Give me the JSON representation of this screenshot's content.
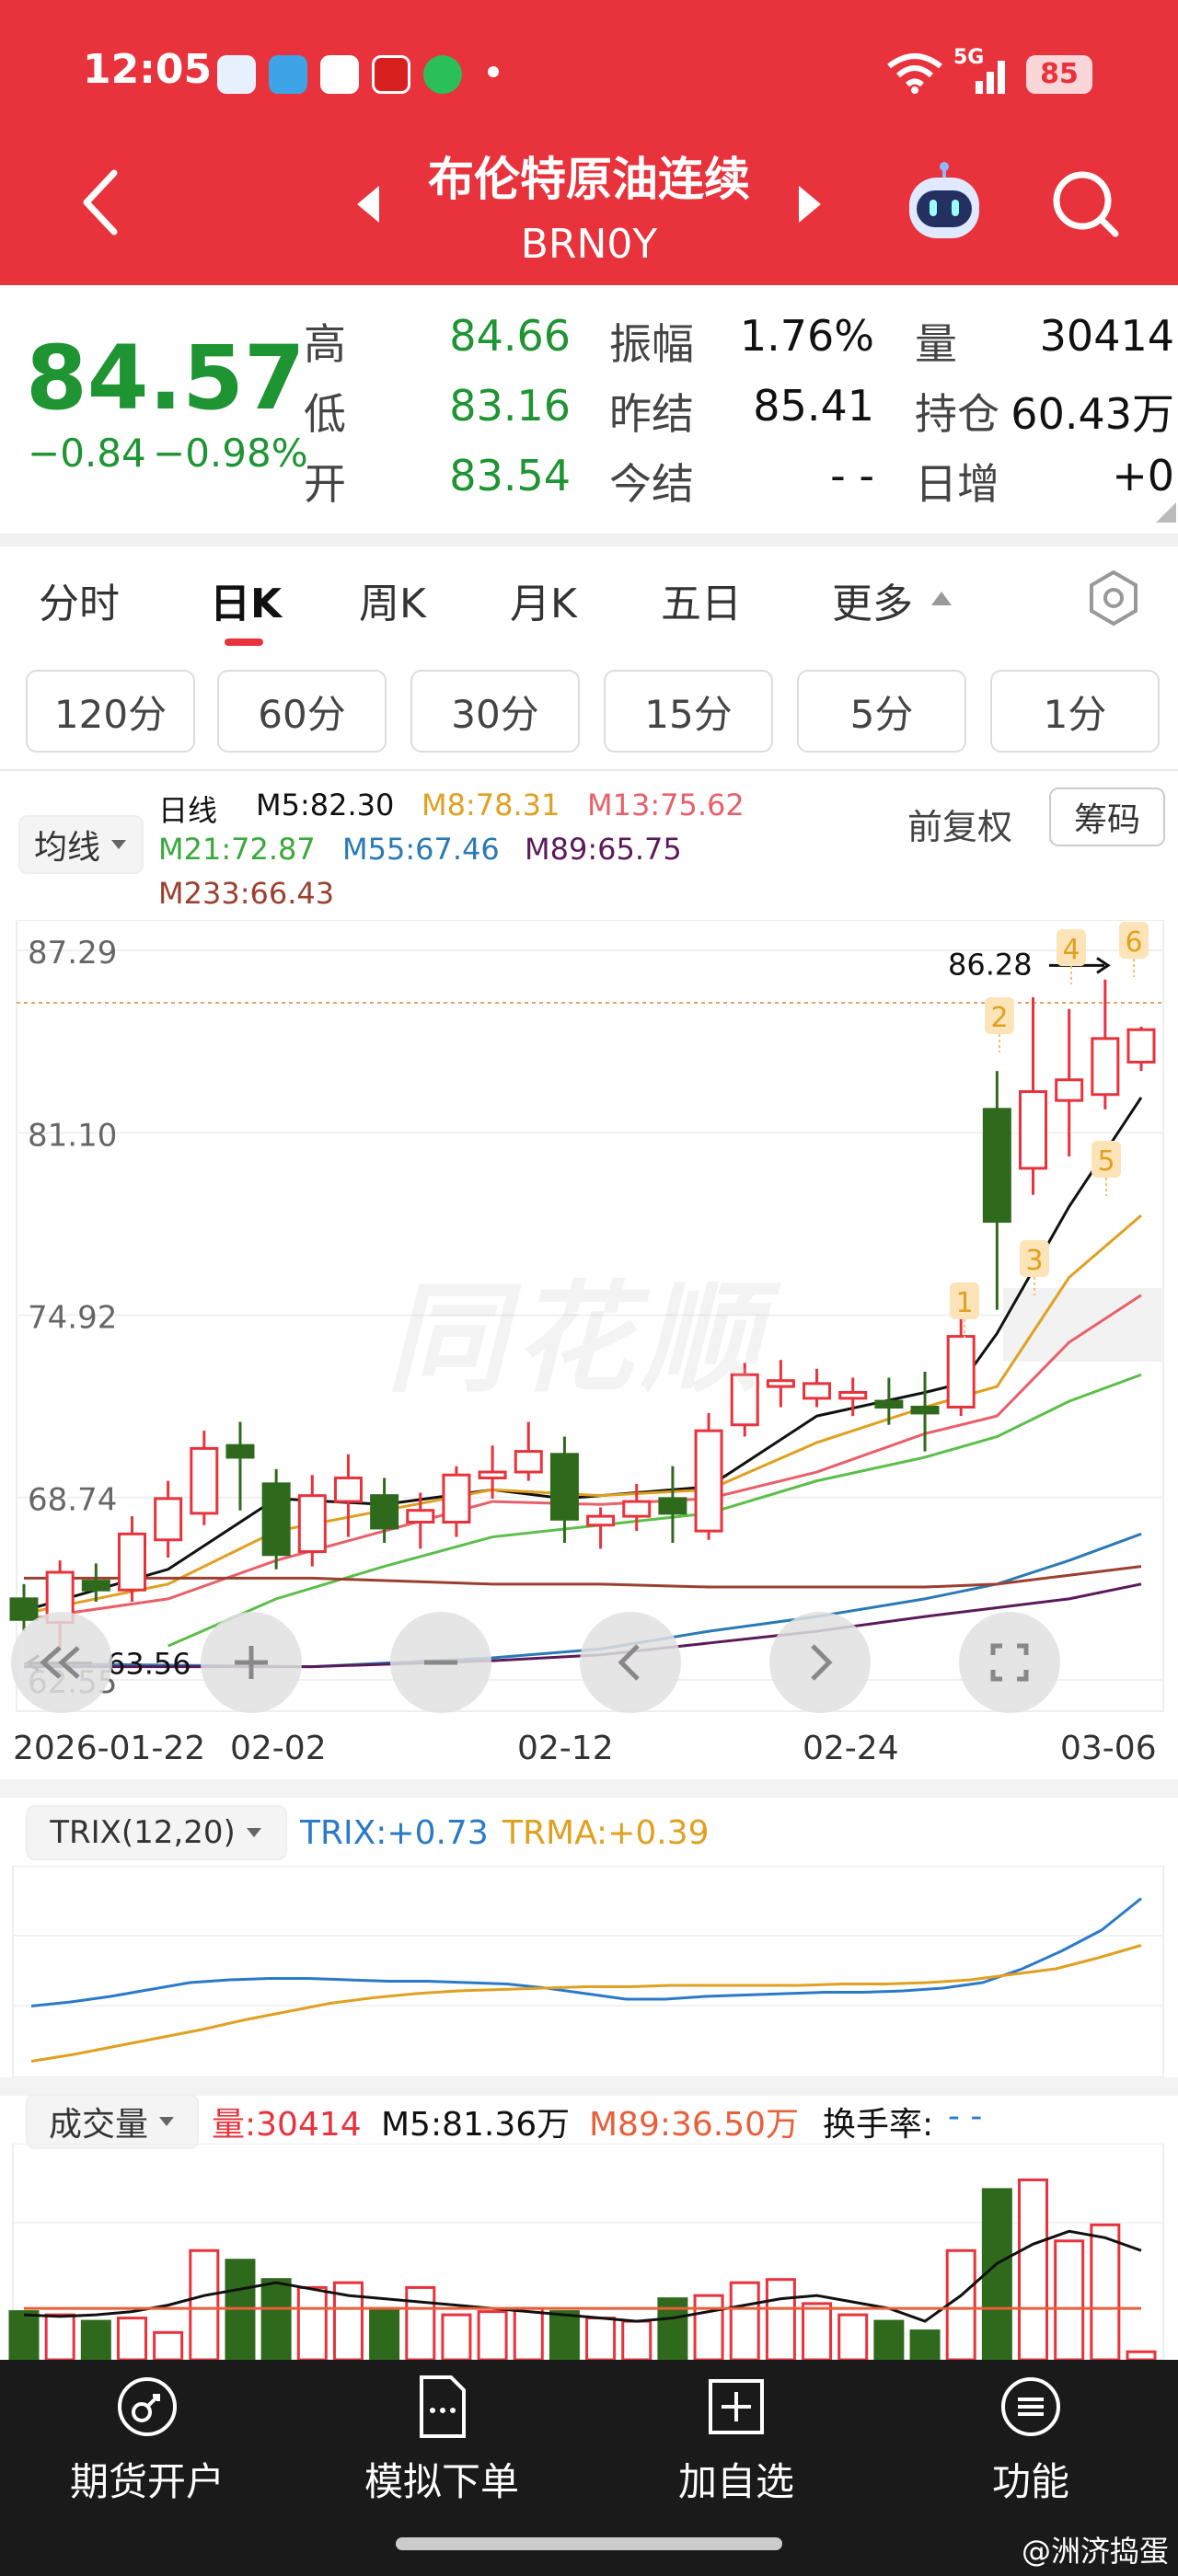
{
  "status": {
    "time": "12:05",
    "network": "5G",
    "battery": "85"
  },
  "header": {
    "title": "布伦特原油连续",
    "code": "BRN0Y"
  },
  "quote": {
    "price": "84.57",
    "change": "−0.84",
    "change_pct": "−0.98%",
    "high_label": "高",
    "high": "84.66",
    "low_label": "低",
    "low": "83.16",
    "open_label": "开",
    "open": "83.54",
    "amplitude_label": "振幅",
    "amplitude": "1.76%",
    "prev_settle_label": "昨结",
    "prev_settle": "85.41",
    "settle_label": "今结",
    "settle": "- -",
    "volume_label": "量",
    "volume": "30414",
    "position_label": "持仓",
    "position": "60.43万",
    "daily_inc_label": "日增",
    "daily_inc": "+0"
  },
  "tabs": [
    "分时",
    "日K",
    "周K",
    "月K",
    "五日",
    "更多"
  ],
  "chips": [
    "120分",
    "60分",
    "30分",
    "15分",
    "5分",
    "1分"
  ],
  "ma": {
    "selector": "均线",
    "period": "日线",
    "m5": "M5:82.30",
    "m8": "M8:78.31",
    "m13": "M13:75.62",
    "m21": "M21:72.87",
    "m55": "M55:67.46",
    "m89": "M89:65.75",
    "m233": "M233:66.43",
    "adjust": "前复权",
    "chip_button": "筹码"
  },
  "watermark": "同花顺",
  "chart_data": {
    "type": "candlestick",
    "y_ticks": [
      "87.29",
      "81.10",
      "74.92",
      "68.74",
      "62.55"
    ],
    "ylim": [
      62.55,
      87.29
    ],
    "x_ticks": [
      "2026-01-22",
      "02-02",
      "02-12",
      "02-24",
      "03-06"
    ],
    "high_marker": "86.28",
    "low_marker": "63.56",
    "badges": [
      "1",
      "2",
      "3",
      "4",
      "5",
      "6"
    ],
    "candles": [
      {
        "o": 65.3,
        "h": 65.8,
        "l": 64.2,
        "c": 64.6
      },
      {
        "o": 64.5,
        "h": 66.6,
        "l": 63.6,
        "c": 66.2
      },
      {
        "o": 65.9,
        "h": 66.5,
        "l": 65.2,
        "c": 65.6
      },
      {
        "o": 65.6,
        "h": 68.1,
        "l": 65.2,
        "c": 67.5
      },
      {
        "o": 67.3,
        "h": 69.3,
        "l": 66.7,
        "c": 68.7
      },
      {
        "o": 68.2,
        "h": 71.0,
        "l": 67.8,
        "c": 70.4
      },
      {
        "o": 70.5,
        "h": 71.3,
        "l": 68.3,
        "c": 70.1
      },
      {
        "o": 69.2,
        "h": 69.7,
        "l": 66.3,
        "c": 66.8
      },
      {
        "o": 66.9,
        "h": 69.5,
        "l": 66.4,
        "c": 68.8
      },
      {
        "o": 68.6,
        "h": 70.2,
        "l": 67.4,
        "c": 69.4
      },
      {
        "o": 68.8,
        "h": 69.4,
        "l": 67.2,
        "c": 67.7
      },
      {
        "o": 67.9,
        "h": 68.9,
        "l": 67.0,
        "c": 68.3
      },
      {
        "o": 67.9,
        "h": 69.8,
        "l": 67.4,
        "c": 69.5
      },
      {
        "o": 69.4,
        "h": 70.5,
        "l": 68.7,
        "c": 69.6
      },
      {
        "o": 69.6,
        "h": 71.3,
        "l": 69.3,
        "c": 70.3
      },
      {
        "o": 70.2,
        "h": 70.8,
        "l": 67.2,
        "c": 68.0
      },
      {
        "o": 67.8,
        "h": 68.4,
        "l": 67.0,
        "c": 68.1
      },
      {
        "o": 68.1,
        "h": 69.2,
        "l": 67.6,
        "c": 68.6
      },
      {
        "o": 68.7,
        "h": 69.8,
        "l": 67.2,
        "c": 68.2
      },
      {
        "o": 67.6,
        "h": 71.6,
        "l": 67.3,
        "c": 71.0
      },
      {
        "o": 71.2,
        "h": 73.3,
        "l": 70.8,
        "c": 72.9
      },
      {
        "o": 72.5,
        "h": 73.4,
        "l": 71.8,
        "c": 72.7
      },
      {
        "o": 72.1,
        "h": 73.1,
        "l": 71.8,
        "c": 72.6
      },
      {
        "o": 72.1,
        "h": 72.8,
        "l": 71.5,
        "c": 72.3
      },
      {
        "o": 72.0,
        "h": 72.8,
        "l": 71.2,
        "c": 71.8
      },
      {
        "o": 71.8,
        "h": 73.0,
        "l": 70.3,
        "c": 71.6
      },
      {
        "o": 71.8,
        "h": 75.0,
        "l": 71.5,
        "c": 74.2
      },
      {
        "o": 81.9,
        "h": 83.2,
        "l": 75.1,
        "c": 78.1
      },
      {
        "o": 79.9,
        "h": 85.7,
        "l": 79.0,
        "c": 82.5
      },
      {
        "o": 82.2,
        "h": 85.3,
        "l": 80.3,
        "c": 82.9
      },
      {
        "o": 82.4,
        "h": 86.3,
        "l": 81.9,
        "c": 84.3
      },
      {
        "o": 83.5,
        "h": 84.7,
        "l": 83.2,
        "c": 84.6
      }
    ],
    "ma_series": [
      {
        "name": "M5",
        "color": "#111111",
        "values": [
          [
            0,
            64.9
          ],
          [
            4,
            66.3
          ],
          [
            7,
            68.7
          ],
          [
            10,
            68.5
          ],
          [
            13,
            69.0
          ],
          [
            15,
            68.7
          ],
          [
            19,
            69.1
          ],
          [
            22,
            71.5
          ],
          [
            25,
            72.3
          ],
          [
            26,
            72.6
          ],
          [
            27,
            74.3
          ],
          [
            29,
            78.6
          ],
          [
            31,
            82.3
          ]
        ]
      },
      {
        "name": "M8",
        "color": "#e0a020",
        "values": [
          [
            0,
            64.8
          ],
          [
            4,
            65.8
          ],
          [
            7,
            67.6
          ],
          [
            10,
            68.3
          ],
          [
            13,
            69.0
          ],
          [
            16,
            68.8
          ],
          [
            19,
            69.0
          ],
          [
            22,
            70.6
          ],
          [
            25,
            71.8
          ],
          [
            27,
            72.5
          ],
          [
            29,
            76.2
          ],
          [
            31,
            78.3
          ]
        ]
      },
      {
        "name": "M13",
        "color": "#e8606a",
        "values": [
          [
            0,
            64.6
          ],
          [
            4,
            65.3
          ],
          [
            7,
            66.6
          ],
          [
            10,
            67.6
          ],
          [
            13,
            68.6
          ],
          [
            16,
            68.5
          ],
          [
            19,
            68.7
          ],
          [
            22,
            69.6
          ],
          [
            25,
            70.9
          ],
          [
            27,
            71.5
          ],
          [
            29,
            74.0
          ],
          [
            31,
            75.6
          ]
        ]
      },
      {
        "name": "M21",
        "color": "#5bbf4a",
        "values": [
          [
            4,
            63.7
          ],
          [
            7,
            65.3
          ],
          [
            10,
            66.4
          ],
          [
            13,
            67.4
          ],
          [
            16,
            67.8
          ],
          [
            19,
            68.2
          ],
          [
            22,
            69.3
          ],
          [
            25,
            70.1
          ],
          [
            27,
            70.8
          ],
          [
            29,
            72.0
          ],
          [
            31,
            72.9
          ]
        ]
      },
      {
        "name": "M55",
        "color": "#2a7ab5",
        "values": [
          [
            0,
            63.1
          ],
          [
            8,
            63.0
          ],
          [
            13,
            63.3
          ],
          [
            16,
            63.6
          ],
          [
            19,
            64.2
          ],
          [
            22,
            64.7
          ],
          [
            25,
            65.3
          ],
          [
            27,
            65.8
          ],
          [
            29,
            66.6
          ],
          [
            31,
            67.5
          ]
        ]
      },
      {
        "name": "M89",
        "color": "#5b1a5a",
        "values": [
          [
            0,
            63.0
          ],
          [
            8,
            63.0
          ],
          [
            13,
            63.2
          ],
          [
            16,
            63.4
          ],
          [
            19,
            63.8
          ],
          [
            22,
            64.2
          ],
          [
            25,
            64.7
          ],
          [
            27,
            65.0
          ],
          [
            29,
            65.3
          ],
          [
            31,
            65.8
          ]
        ]
      },
      {
        "name": "M233",
        "color": "#9a4030",
        "values": [
          [
            0,
            66.0
          ],
          [
            8,
            66.0
          ],
          [
            13,
            65.8
          ],
          [
            16,
            65.8
          ],
          [
            19,
            65.7
          ],
          [
            22,
            65.7
          ],
          [
            25,
            65.7
          ],
          [
            27,
            65.8
          ],
          [
            29,
            66.1
          ],
          [
            31,
            66.4
          ]
        ]
      }
    ]
  },
  "trix": {
    "selector": "TRIX(12,20)",
    "trix_label": "TRIX:+0.73",
    "trma_label": "TRMA:+0.39",
    "trix_values": [
      -0.05,
      -0.02,
      0.02,
      0.07,
      0.12,
      0.14,
      0.15,
      0.15,
      0.14,
      0.13,
      0.13,
      0.12,
      0.11,
      0.08,
      0.04,
      0.0,
      0.0,
      0.02,
      0.03,
      0.04,
      0.05,
      0.05,
      0.06,
      0.08,
      0.12,
      0.22,
      0.35,
      0.5,
      0.73
    ],
    "trma_values": [
      -0.45,
      -0.4,
      -0.34,
      -0.28,
      -0.22,
      -0.15,
      -0.09,
      -0.03,
      0.01,
      0.04,
      0.06,
      0.07,
      0.08,
      0.09,
      0.09,
      0.1,
      0.1,
      0.1,
      0.1,
      0.11,
      0.11,
      0.12,
      0.14,
      0.18,
      0.22,
      0.3,
      0.39
    ],
    "ylim": [
      -0.5,
      0.9
    ]
  },
  "volume": {
    "selector": "成交量",
    "vol_label": "量:30414",
    "m5_label": "M5:81.36万",
    "m89_label": "M89:36.50万",
    "turnover_label": "换手率:",
    "turnover_value": "- -",
    "bars": [
      30,
      28,
      24,
      26,
      17,
      68,
      62,
      50,
      45,
      48,
      32,
      45,
      28,
      30,
      32,
      30,
      26,
      24,
      38,
      40,
      48,
      50,
      35,
      28,
      24,
      18,
      68,
      106,
      112,
      74,
      84,
      5
    ],
    "ma_line": [
      28,
      27,
      28,
      30,
      34,
      40,
      44,
      48,
      44,
      40,
      38,
      36,
      34,
      32,
      30,
      28,
      26,
      24,
      26,
      30,
      34,
      38,
      40,
      36,
      32,
      24,
      40,
      60,
      72,
      80,
      76,
      68
    ],
    "ma89_line": 32,
    "ymax": 130
  },
  "bottom_nav": [
    {
      "label": "期货开户",
      "icon": "account-icon"
    },
    {
      "label": "模拟下单",
      "icon": "document-icon"
    },
    {
      "label": "加自选",
      "icon": "plus-square-icon"
    },
    {
      "label": "功能",
      "icon": "menu-icon"
    }
  ],
  "credit": "@洲济捣蛋"
}
